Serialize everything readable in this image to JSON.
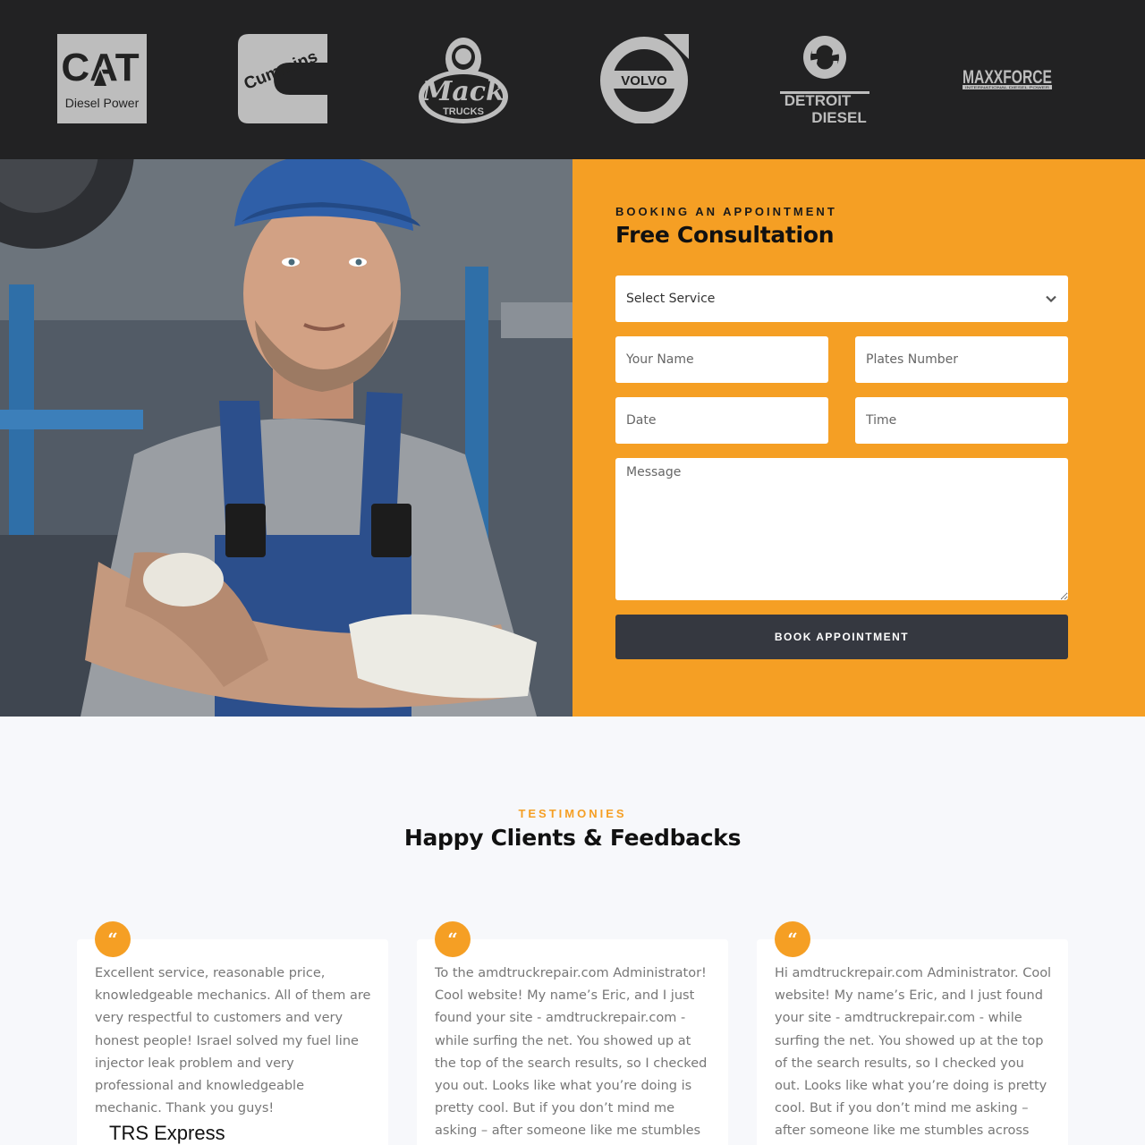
{
  "brands": [
    {
      "name": "CAT Diesel Power",
      "line1": "CAT",
      "line2": "Diesel Power"
    },
    {
      "name": "Cummins",
      "line1": "Cummins"
    },
    {
      "name": "Mack Trucks",
      "line1": "Mack",
      "line2": "TRUCKS"
    },
    {
      "name": "Volvo",
      "line1": "VOLVO"
    },
    {
      "name": "Detroit Diesel",
      "line1": "DETROIT",
      "line2": "DIESEL"
    },
    {
      "name": "Maxxforce",
      "line1": "MAXXFORCE",
      "line2": "INTERNATIONAL DIESEL POWER"
    }
  ],
  "booking": {
    "eyebrow": "BOOKING AN APPOINTMENT",
    "title": "Free Consultation",
    "service_select": {
      "value": "Select Service",
      "icon": "chevron-down-icon"
    },
    "name_placeholder": "Your Name",
    "plates_placeholder": "Plates Number",
    "date_placeholder": "Date",
    "time_placeholder": "Time",
    "message_placeholder": "Message",
    "submit_label": "BOOK APPOINTMENT"
  },
  "testimonials": {
    "eyebrow": "TESTIMONIES",
    "title": "Happy Clients & Feedbacks",
    "quote_glyph": "“",
    "items": [
      {
        "text": "Excellent service, reasonable price, knowledgeable mechanics. All of them are very respectful to customers and very honest people! Israel solved my fuel line injector leak problem and very professional and knowledgeable mechanic. Thank you guys!",
        "author": "TRS Express"
      },
      {
        "text": "To the amdtruckrepair.com Administrator! Cool website! My name’s Eric, and I just found your site - amdtruckrepair.com - while surfing the net. You showed up at the top of the search results, so I checked you out. Looks like what you’re doing is pretty cool. But if you don’t mind me asking – after someone like me stumbles across",
        "author": ""
      },
      {
        "text": "Hi amdtruckrepair.com Administrator. Cool website! My name’s Eric, and I just found your site - amdtruckrepair.com - while surfing the net. You showed up at the top of the search results, so I checked you out. Looks like what you’re doing is pretty cool. But if you don’t mind me asking – after someone like me stumbles across",
        "author": ""
      }
    ]
  },
  "colors": {
    "accent": "#f59f24",
    "dark_bar": "#222223",
    "button": "#353840",
    "logo_grey": "#bdbdbd"
  }
}
